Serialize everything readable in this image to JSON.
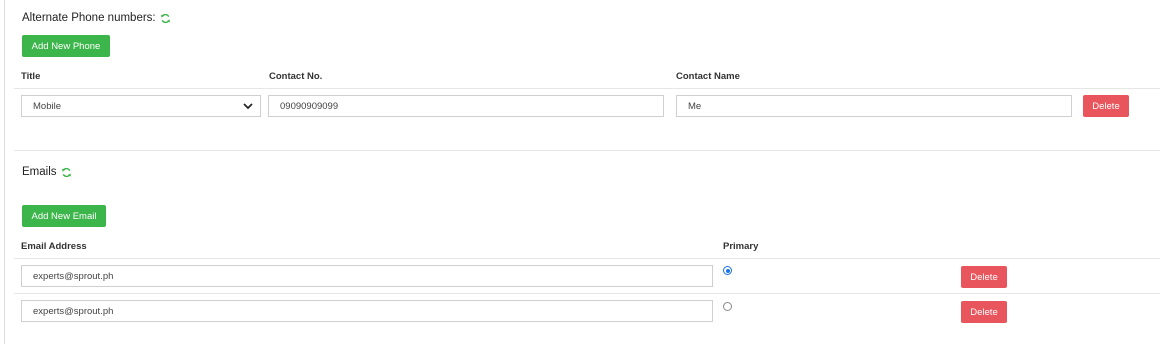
{
  "phones": {
    "title": "Alternate Phone numbers:",
    "add_button": "Add New Phone",
    "columns": {
      "title": "Title",
      "contact_no": "Contact No.",
      "contact_name": "Contact Name"
    },
    "rows": [
      {
        "title": "Mobile",
        "contact_no": "09090909099",
        "contact_name": "Me",
        "delete_label": "Delete"
      }
    ]
  },
  "emails": {
    "title": "Emails",
    "add_button": "Add New Email",
    "columns": {
      "email": "Email Address",
      "primary": "Primary"
    },
    "rows": [
      {
        "email": "experts@sprout.ph",
        "primary": true,
        "delete_label": "Delete"
      },
      {
        "email": "experts@sprout.ph",
        "primary": false,
        "delete_label": "Delete"
      }
    ]
  },
  "colors": {
    "accent_green": "#3cb54a",
    "danger_red": "#e8555c",
    "radio_blue": "#1a73e8"
  },
  "icons": {
    "refresh": "refresh-icon",
    "dropdown": "chevron-down-icon"
  }
}
